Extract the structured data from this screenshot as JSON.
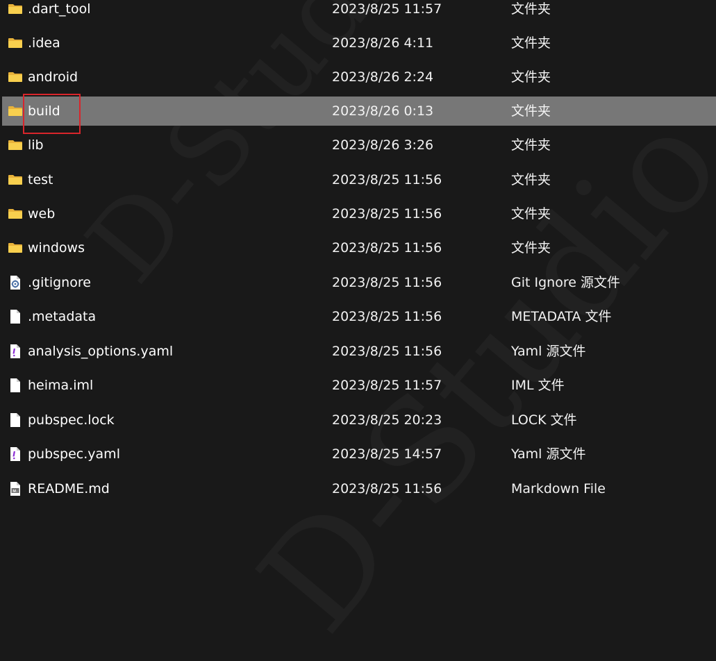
{
  "watermark": "D-Studio",
  "selected_index": 3,
  "rows": [
    {
      "name": ".dart_tool",
      "date": "2023/8/25 11:57",
      "type": "文件夹",
      "icon": "folder-icon"
    },
    {
      "name": ".idea",
      "date": "2023/8/26 4:11",
      "type": "文件夹",
      "icon": "folder-icon"
    },
    {
      "name": "android",
      "date": "2023/8/26 2:24",
      "type": "文件夹",
      "icon": "folder-icon"
    },
    {
      "name": "build",
      "date": "2023/8/26 0:13",
      "type": "文件夹",
      "icon": "folder-icon"
    },
    {
      "name": "lib",
      "date": "2023/8/26 3:26",
      "type": "文件夹",
      "icon": "folder-icon"
    },
    {
      "name": "test",
      "date": "2023/8/25 11:56",
      "type": "文件夹",
      "icon": "folder-icon"
    },
    {
      "name": "web",
      "date": "2023/8/25 11:56",
      "type": "文件夹",
      "icon": "folder-icon"
    },
    {
      "name": "windows",
      "date": "2023/8/25 11:56",
      "type": "文件夹",
      "icon": "folder-icon"
    },
    {
      "name": ".gitignore",
      "date": "2023/8/25 11:56",
      "type": "Git Ignore 源文件",
      "icon": "gear-file-icon"
    },
    {
      "name": ".metadata",
      "date": "2023/8/25 11:56",
      "type": "METADATA 文件",
      "icon": "blank-file-icon"
    },
    {
      "name": "analysis_options.yaml",
      "date": "2023/8/25 11:56",
      "type": "Yaml 源文件",
      "icon": "yaml-file-icon"
    },
    {
      "name": "heima.iml",
      "date": "2023/8/25 11:57",
      "type": "IML 文件",
      "icon": "blank-file-icon"
    },
    {
      "name": "pubspec.lock",
      "date": "2023/8/25 20:23",
      "type": "LOCK 文件",
      "icon": "blank-file-icon"
    },
    {
      "name": "pubspec.yaml",
      "date": "2023/8/25 14:57",
      "type": "Yaml 源文件",
      "icon": "yaml-file-icon"
    },
    {
      "name": "README.md",
      "date": "2023/8/25 11:56",
      "type": "Markdown File",
      "icon": "markdown-file-icon"
    }
  ],
  "colors": {
    "background": "#191919",
    "selected_row": "#777777",
    "highlight_border": "#d9252b",
    "folder": "#f5c43c"
  }
}
